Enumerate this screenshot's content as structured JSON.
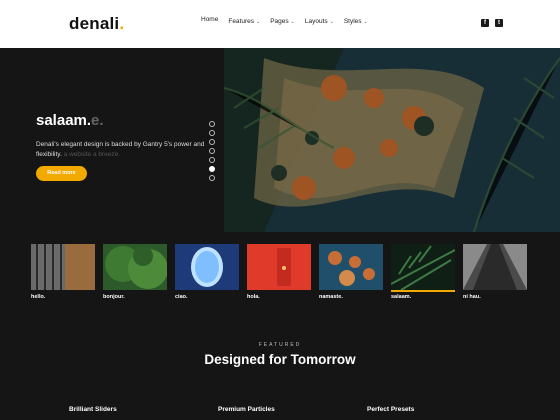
{
  "brand": {
    "name": "denali",
    "dot": ".",
    "accent": "#f2a900"
  },
  "nav": {
    "home": "Home",
    "items": [
      {
        "label": "Features"
      },
      {
        "label": "Pages"
      },
      {
        "label": "Layouts"
      },
      {
        "label": "Styles"
      }
    ]
  },
  "social": [
    "facebook-icon",
    "twitter-icon"
  ],
  "hero": {
    "title_main": "salaam.",
    "title_ghost": "e.",
    "desc_main": "Denali's elegant design is backed by Gantry 5's power and flexibility.",
    "desc_ghost": "a website a breeze.",
    "button": "Read more",
    "slide_count": 7,
    "active_slide": 6
  },
  "thumbs": [
    {
      "label": "hello."
    },
    {
      "label": "bonjour."
    },
    {
      "label": "ciao."
    },
    {
      "label": "hola."
    },
    {
      "label": "namaste."
    },
    {
      "label": "salaam."
    },
    {
      "label": "ni hau."
    }
  ],
  "featured": {
    "eyebrow": "FEATURED",
    "headline": "Designed for Tomorrow",
    "items": [
      "Brilliant Sliders",
      "Premium Particles",
      "Perfect Presets"
    ]
  }
}
